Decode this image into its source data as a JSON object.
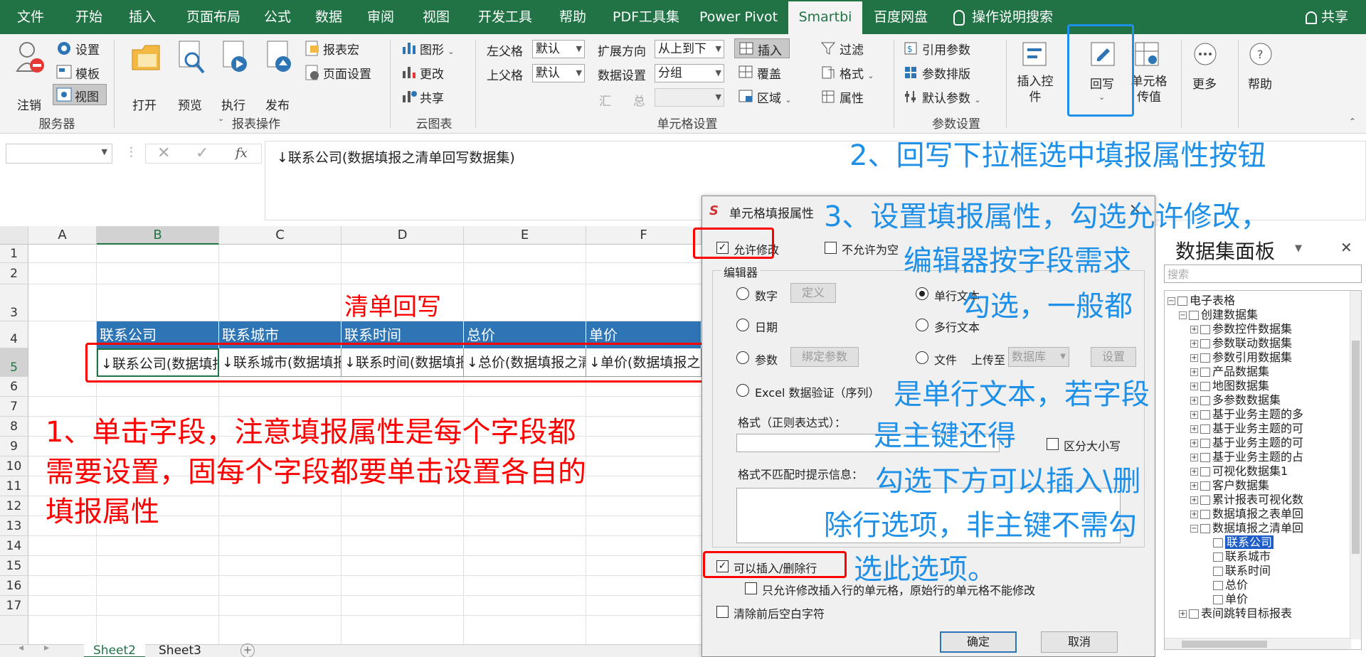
{
  "tabs": [
    "文件",
    "开始",
    "插入",
    "页面布局",
    "公式",
    "数据",
    "审阅",
    "视图",
    "开发工具",
    "帮助",
    "PDF工具集",
    "Power Pivot",
    "Smartbi",
    "百度网盘"
  ],
  "search_label": "操作说明搜索",
  "share_label": "共享",
  "ribbon": {
    "server": {
      "logout": "注销",
      "settings": "设置",
      "template": "模板",
      "view": "视图",
      "group": "服务器"
    },
    "report": {
      "open": "打开",
      "preview": "预览",
      "execute": "执行",
      "publish": "发布",
      "macro": "报表宏",
      "page_setup": "页面设置",
      "group": "报表操作"
    },
    "cloud": {
      "graph": "图形",
      "change": "更改",
      "share": "共享",
      "group": "云图表"
    },
    "cell": {
      "left_parent": "左父格",
      "top_parent": "上父格",
      "left_val": "默认",
      "top_val": "默认",
      "expand_dir": "扩展方向",
      "expand_val": "从上到下",
      "data_setting": "数据设置",
      "data_val": "分组",
      "sum": "汇",
      "total": "总",
      "insert": "插入",
      "cover": "覆盖",
      "area": "区域",
      "filter": "过滤",
      "format": "格式",
      "attr": "属性",
      "group": "单元格设置"
    },
    "param": {
      "ref": "引用参数",
      "layout": "参数排版",
      "default": "默认参数",
      "group": "参数设置"
    },
    "insert_ctrl": "插入控件",
    "writeback": "回写",
    "cell_pass": "单元格传值",
    "more": "更多",
    "help": "帮助"
  },
  "formula": {
    "content": "↓联系公司(数据填报之清单回写数据集)"
  },
  "columns": [
    "A",
    "B",
    "C",
    "D",
    "E",
    "F"
  ],
  "rows": [
    "1",
    "2",
    "3",
    "4",
    "5",
    "6",
    "7",
    "8",
    "9",
    "10",
    "11",
    "12",
    "13",
    "14",
    "15",
    "16",
    "17"
  ],
  "sheet": {
    "title": "清单回写",
    "headers": [
      "联系公司",
      "联系城市",
      "联系时间",
      "总价",
      "单价"
    ],
    "cells": [
      "↓联系公司(数据填报之清单回写数据集)",
      "↓联系城市(数据填报之清单回写数据集)",
      "↓联系时间(数据填报之清单回写数据集)",
      "↓总价(数据填报之清单回写数据集)",
      "↓单价(数据填报之清单回写数据集)"
    ]
  },
  "sheet_tabs": [
    "Sheet2",
    "Sheet3"
  ],
  "notes": {
    "n1": [
      "1、单击字段，注意填报属性是每个字段都",
      "需要设置，固每个字段都要单击设置各自的",
      "填报属性"
    ],
    "n2": "2、回写下拉框选中填报属性按钮",
    "n3a": "3、设置填报属性，勾选允许修改，",
    "n3b": "编辑器按字段需求",
    "n3c": "勾选，一般都",
    "n3d": "是单行文本，若字段",
    "n3e": "是主键还得",
    "n3f": "勾选下方可以插入\\删",
    "n3g": "除行选项，非主键不需勾",
    "n3h": "选此选项。"
  },
  "dialog": {
    "title": "单元格填报属性",
    "allow_modify": "允许修改",
    "not_null": "不允许为空",
    "editor": "编辑器",
    "number": "数字",
    "define": "定义",
    "single_text": "单行文本",
    "date": "日期",
    "multi_text": "多行文本",
    "param": "参数",
    "bind_param": "绑定参数",
    "file": "文件",
    "upload_to": "上传至",
    "database": "数据库",
    "setting": "设置",
    "excel_validation": "Excel 数据验证（序列）",
    "format_regex": "格式（正则表达式）：",
    "case_sensitive": "区分大小写",
    "mismatch_tip": "格式不匹配时提示信息：",
    "insert_delete": "可以插入/删除行",
    "only_insert": "只允许修改插入行的单元格，原始行的单元格不能修改",
    "trim": "清除前后空白字符",
    "ok": "确定",
    "cancel": "取消"
  },
  "panel": {
    "title": "数据集面板",
    "search": "搜索",
    "tree": [
      "电子表格",
      "创建数据集",
      "参数控件数据集",
      "参数联动数据集",
      "参数引用数据集",
      "产品数据集",
      "地图数据集",
      "多参数数据集",
      "基于业务主题的多",
      "基于业务主题的可",
      "基于业务主题的可",
      "基于业务主题的占",
      "可视化数据集1",
      "客户数据集",
      "累计报表可视化数",
      "数据填报之表单回",
      "数据填报之清单回",
      "联系公司",
      "联系城市",
      "联系时间",
      "总价",
      "单价",
      "表间跳转目标报表"
    ]
  }
}
